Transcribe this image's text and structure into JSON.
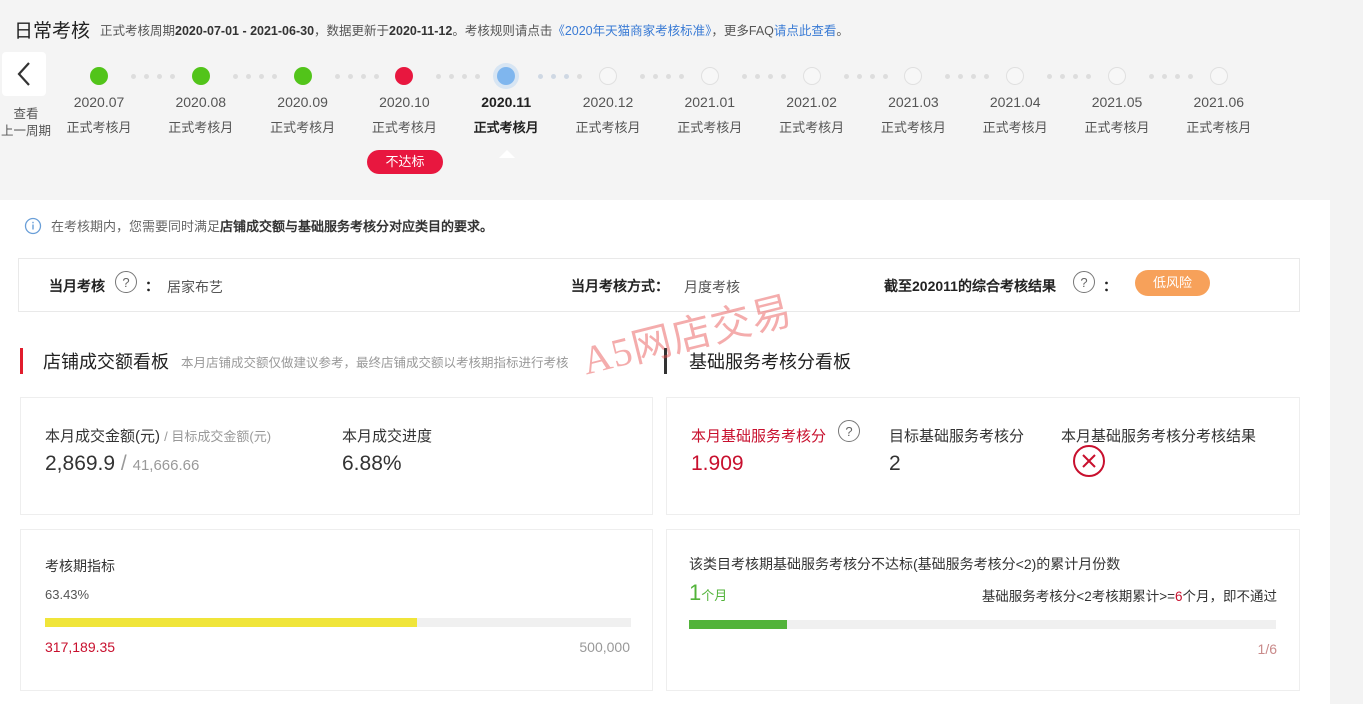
{
  "header": {
    "title": "日常考核",
    "meta_prefix": "正式考核周期",
    "period": "2020-07-01 - 2021-06-30",
    "updated_prefix": "，数据更新于",
    "updated": "2020-11-12",
    "rules_prefix": "。考核规则请点击",
    "rules_link": "《2020年天猫商家考核标准》",
    "faq_prefix": "，更多FAQ",
    "faq_link": "请点此查看",
    "faq_suffix": "。"
  },
  "back": {
    "label_line1": "查看",
    "label_line2": "上一周期"
  },
  "timeline": {
    "months": [
      {
        "month": "2020.07",
        "sub": "正式考核月",
        "status": "passed"
      },
      {
        "month": "2020.08",
        "sub": "正式考核月",
        "status": "passed"
      },
      {
        "month": "2020.09",
        "sub": "正式考核月",
        "status": "passed"
      },
      {
        "month": "2020.10",
        "sub": "正式考核月",
        "status": "failed"
      },
      {
        "month": "2020.11",
        "sub": "正式考核月",
        "status": "current"
      },
      {
        "month": "2020.12",
        "sub": "正式考核月",
        "status": "future"
      },
      {
        "month": "2021.01",
        "sub": "正式考核月",
        "status": "future"
      },
      {
        "month": "2021.02",
        "sub": "正式考核月",
        "status": "future"
      },
      {
        "month": "2021.03",
        "sub": "正式考核月",
        "status": "future"
      },
      {
        "month": "2021.04",
        "sub": "正式考核月",
        "status": "future"
      },
      {
        "month": "2021.05",
        "sub": "正式考核月",
        "status": "future"
      },
      {
        "month": "2021.06",
        "sub": "正式考核月",
        "status": "future"
      }
    ],
    "fail_badge": "不达标",
    "colors": {
      "passed": "#52c41a",
      "failed": "#e8173f",
      "current": "#7fb6ee",
      "future": "#eeeeee"
    }
  },
  "notice": {
    "prefix": "在考核期内，您需要同时满足",
    "bold": "店铺成交额与基础服务考核分对应类目的要求。"
  },
  "info": {
    "category_label": "当月考核",
    "category_value": "居家布艺",
    "method_label": "当月考核方式：",
    "method_value": "月度考核",
    "result_label": "截至202011的综合考核结果",
    "result_value": "低风险",
    "colon": "："
  },
  "sales_board": {
    "title": "店铺成交额看板",
    "note": "本月店铺成交额仅做建议参考，最终店铺成交额以考核期指标进行考核",
    "amount_label": "本月成交金额(元)",
    "target_label": "/ 目标成交金额(元)",
    "amount": "2,869.9",
    "slash": "/",
    "target": "41,666.66",
    "progress_label": "本月成交进度",
    "progress": "6.88%",
    "period_label": "考核期指标",
    "period_percent": "63.43%",
    "period_fraction": 0.6343,
    "period_value": "317,189.35",
    "period_target": "500,000",
    "bar_color": "#f0e53a"
  },
  "service_board": {
    "title": "基础服务考核分看板",
    "score_label": "本月基础服务考核分",
    "score": "1.909",
    "target_label": "目标基础服务考核分",
    "target": "2",
    "result_label": "本月基础服务考核分考核结果",
    "result_icon": "fail-x-icon",
    "months_label": "该类目考核期基础服务考核分不达标(基础服务考核分<2)的累计月份数",
    "months_count": "1",
    "months_unit": "个月",
    "rule_text_a": "基础服务考核分<2考核期累计>=",
    "rule_num": "6",
    "rule_text_b": "个月，即不通过",
    "ratio": "1/6",
    "fraction": 0.1667,
    "bar_color": "#52b33a"
  },
  "watermark": "A5网店交易"
}
